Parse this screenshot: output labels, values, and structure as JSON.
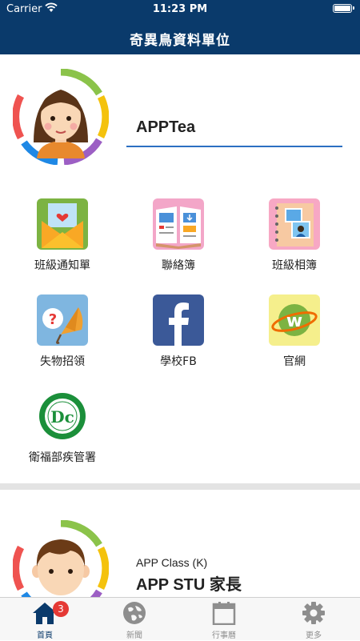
{
  "status_bar": {
    "carrier": "Carrier",
    "time": "11:23 PM"
  },
  "header": {
    "title": "奇異鳥資料單位"
  },
  "profile": {
    "name": "APPTea"
  },
  "grid": [
    {
      "label": "班級通知單",
      "icon": "envelope-icon"
    },
    {
      "label": "聯絡簿",
      "icon": "contact-book-icon"
    },
    {
      "label": "班級相簿",
      "icon": "photo-album-icon"
    },
    {
      "label": "失物招領",
      "icon": "lost-and-found-icon"
    },
    {
      "label": "學校FB",
      "icon": "facebook-icon"
    },
    {
      "label": "官網",
      "icon": "website-icon"
    },
    {
      "label": "衛福部疾管署",
      "icon": "cdc-icon"
    }
  ],
  "student": {
    "class": "APP Class (K)",
    "name": "APP STU 家長"
  },
  "tabbar": {
    "items": [
      {
        "label": "首頁",
        "icon": "home-icon",
        "active": true,
        "badge": "3"
      },
      {
        "label": "新聞",
        "icon": "globe-icon",
        "active": false
      },
      {
        "label": "行事曆",
        "icon": "calendar-icon",
        "active": false
      },
      {
        "label": "更多",
        "icon": "gear-icon",
        "active": false
      }
    ]
  },
  "colors": {
    "header": "#0a3a6b",
    "accent": "#2c6fc2",
    "badge": "#e53935"
  }
}
